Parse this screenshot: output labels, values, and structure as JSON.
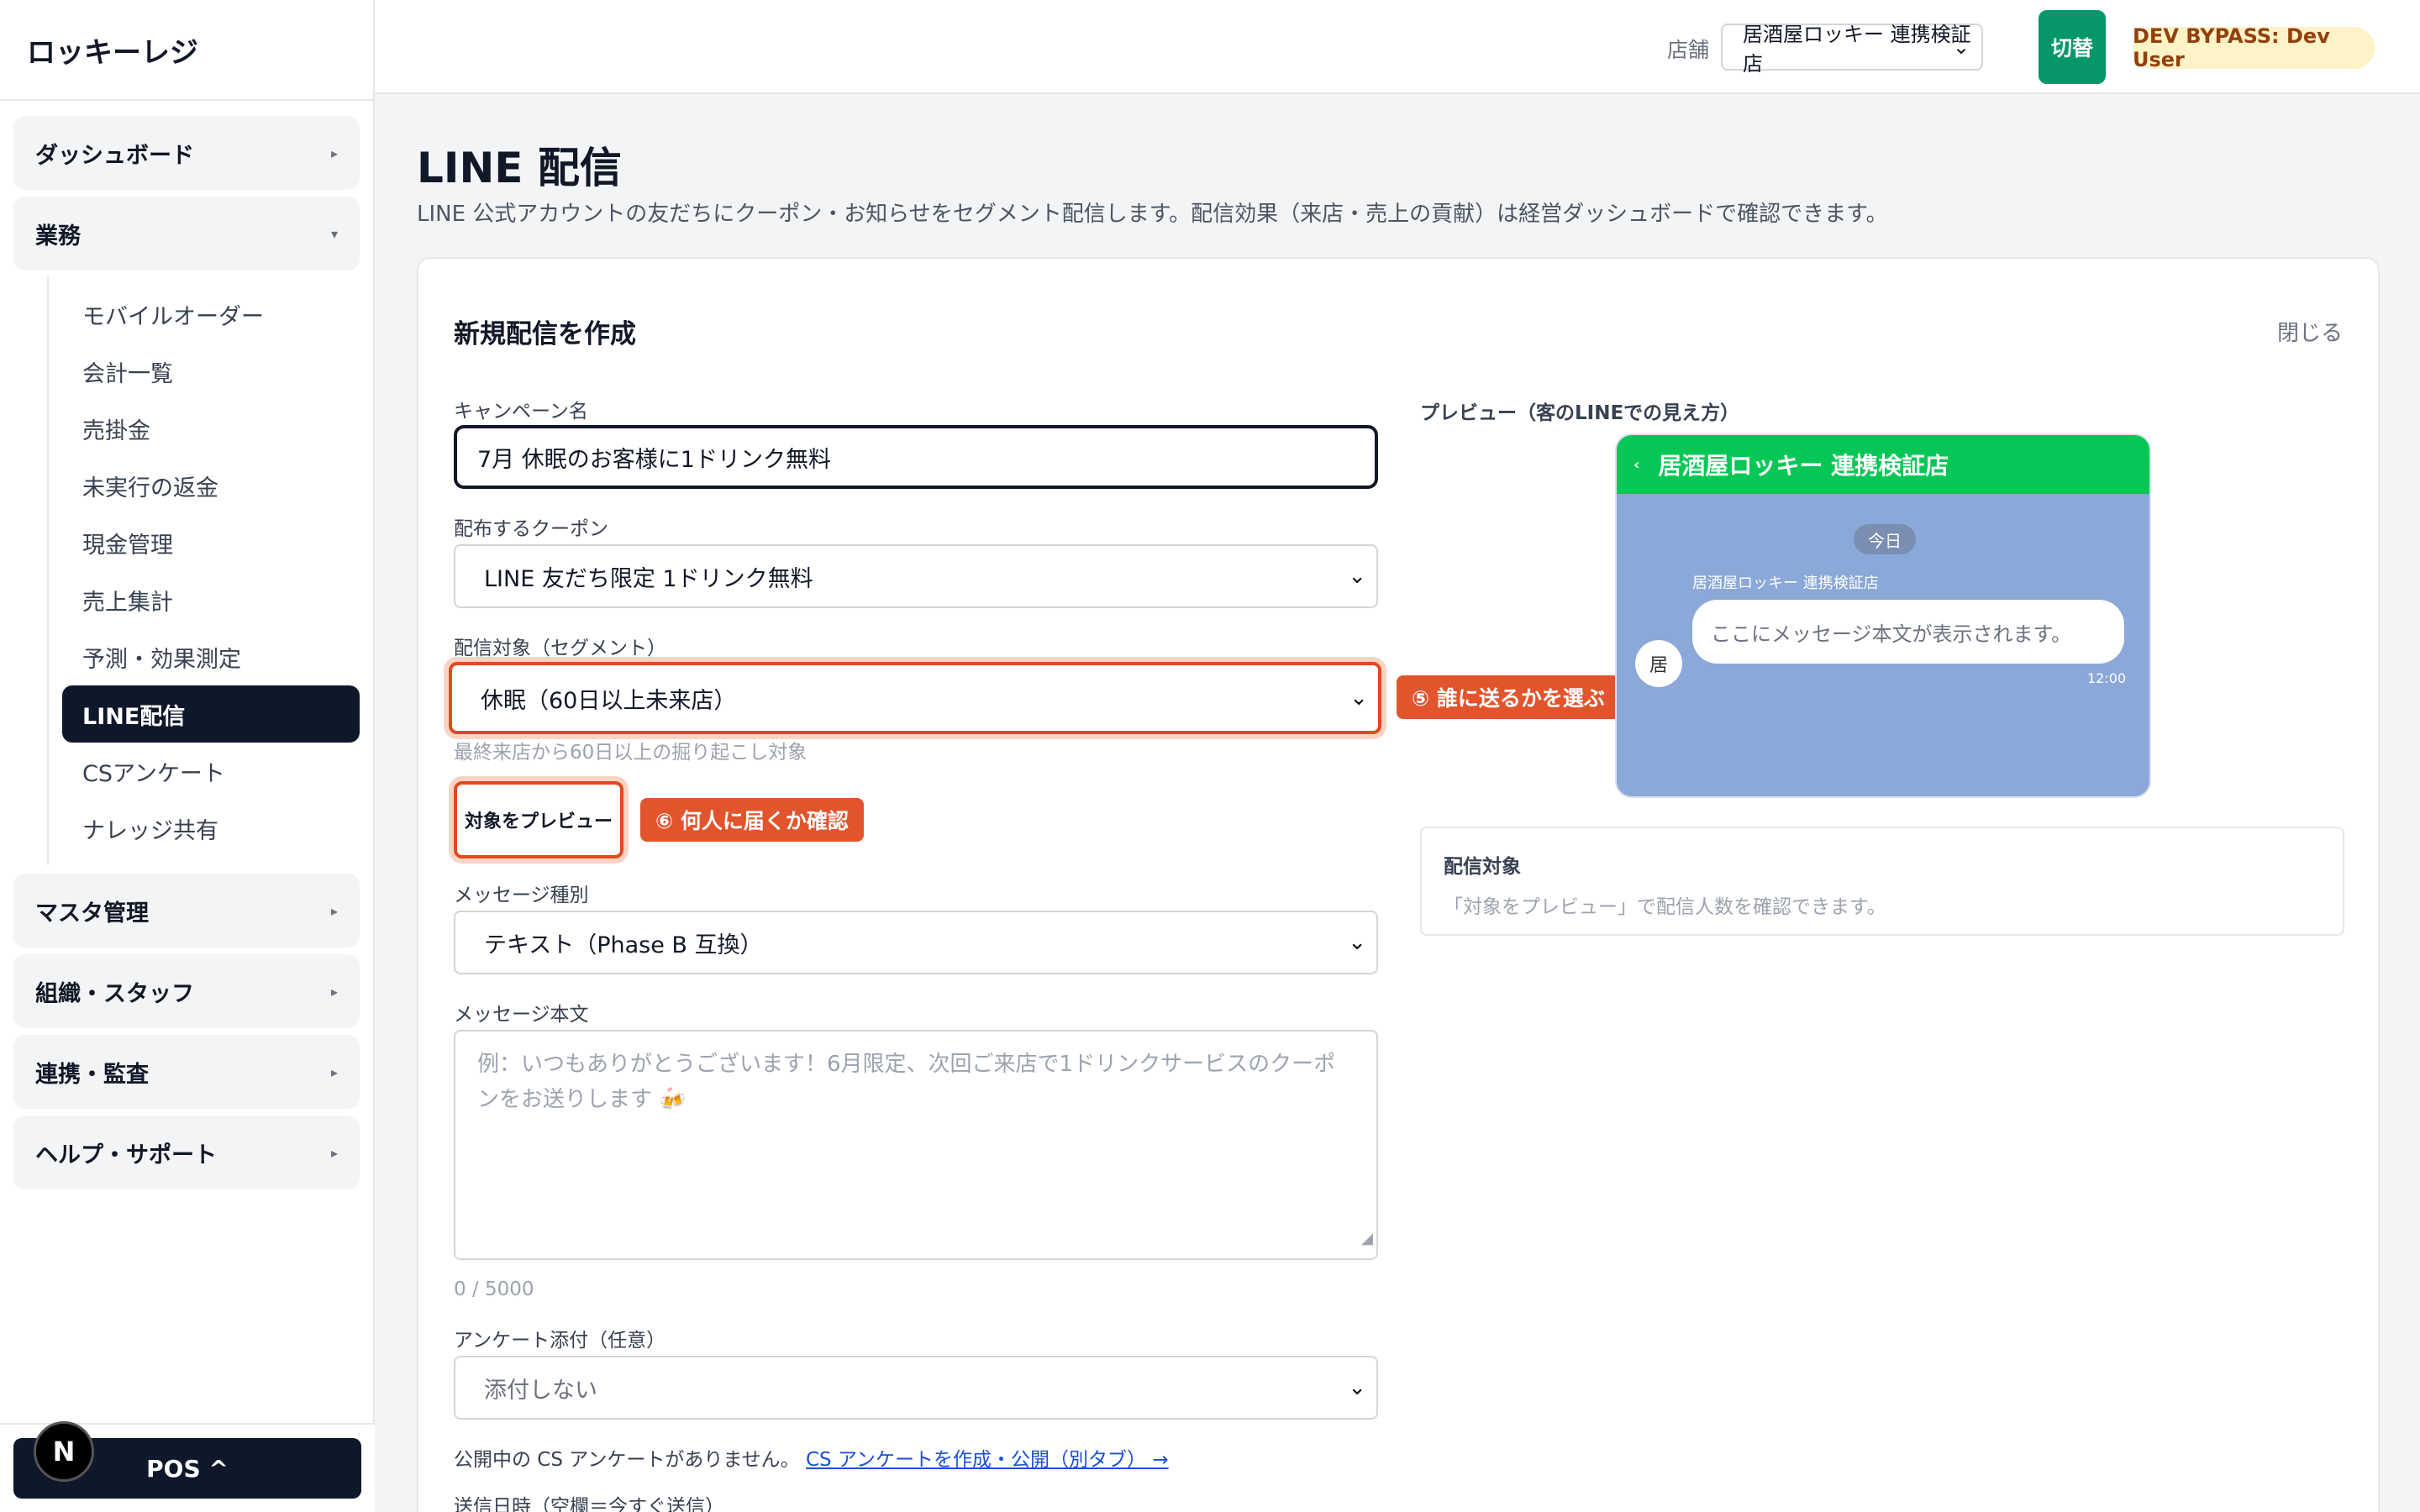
{
  "app": {
    "brand": "ロッキーレジ"
  },
  "sidebar": {
    "groups": [
      {
        "label": "ダッシュボード",
        "caret": "▸"
      },
      {
        "label": "業務",
        "caret": "▾"
      },
      {
        "label": "マスタ管理",
        "caret": "▸"
      },
      {
        "label": "組織・スタッフ",
        "caret": "▸"
      },
      {
        "label": "連携・監査",
        "caret": "▸"
      },
      {
        "label": "ヘルプ・サポート",
        "caret": "▸"
      }
    ],
    "sub_items": [
      "モバイルオーダー",
      "会計一覧",
      "売掛金",
      "未実行の返金",
      "現金管理",
      "売上集計",
      "予測・効果測定",
      "LINE配信",
      "CSアンケート",
      "ナレッジ共有"
    ],
    "active_item": "LINE配信",
    "pos_button": "POS ^",
    "next_badge": "N"
  },
  "topbar": {
    "store_label": "店舗",
    "store_value": "居酒屋ロッキー 連携検証店",
    "switch_button": "切替",
    "user_badge": "DEV BYPASS: Dev User"
  },
  "page": {
    "title": "LINE 配信",
    "description": "LINE 公式アカウントの友だちにクーポン・お知らせをセグメント配信します。配信効果（来店・売上の貢献）は経営ダッシュボードで確認できます。"
  },
  "form": {
    "title": "新規配信を作成",
    "close": "閉じる",
    "campaign_label": "キャンペーン名",
    "campaign_value": "7月 休眠のお客様に1ドリンク無料",
    "coupon_label": "配布するクーポン",
    "coupon_value": "LINE 友だち限定 1ドリンク無料",
    "segment_label": "配信対象（セグメント）",
    "segment_value": "休眠（60日以上未来店）",
    "segment_hint": "最終来店から60日以上の掘り起こし対象",
    "segment_callout": "⑤ 誰に送るかを選ぶ",
    "preview_button": "対象をプレビュー",
    "preview_callout": "⑥ 何人に届くか確認",
    "message_type_label": "メッセージ種別",
    "message_type_value": "テキスト（Phase B 互換）",
    "message_body_label": "メッセージ本文",
    "message_body_placeholder": "例：いつもありがとうございます！6月限定、次回ご来店で1ドリンクサービスのクーポンをお送りします 🍻",
    "char_count": "0 / 5000",
    "survey_label": "アンケート添付（任意）",
    "survey_value": "添付しない",
    "survey_note": "公開中の CS アンケートがありません。",
    "survey_link": "CS アンケートを作成・公開（別タブ） →",
    "schedule_label": "送信日時（空欄＝今すぐ送信）"
  },
  "preview": {
    "label": "プレビュー（客のLINEでの見え方）",
    "header_back": "‹",
    "header_title": "居酒屋ロッキー 連携検証店",
    "date_chip": "今日",
    "sender_name": "居酒屋ロッキー 連携検証店",
    "avatar_char": "居",
    "bubble_text": "ここにメッセージ本文が表示されます。",
    "time": "12:00",
    "target_title": "配信対象",
    "target_desc": "「対象をプレビュー」で配信人数を確認できます。"
  },
  "colors": {
    "line_green": "#06c755",
    "highlight": "#e04a1c",
    "switch_green": "#059669",
    "active_nav": "#0f172a"
  }
}
